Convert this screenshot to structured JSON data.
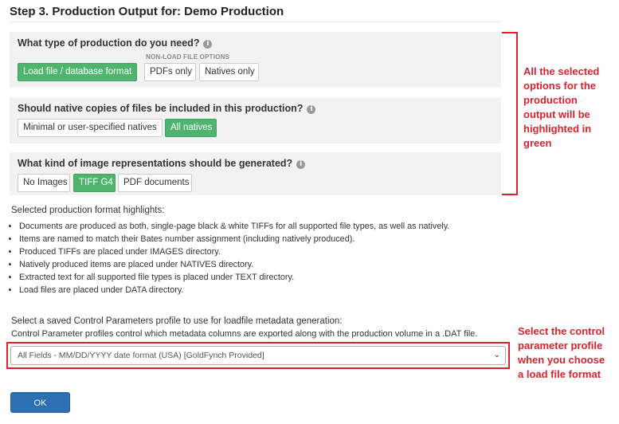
{
  "step_title": "Step 3. Production Output for: Demo Production",
  "panels": {
    "production_type": {
      "question": "What type of production do you need?",
      "options": [
        {
          "label": "Load file / database format",
          "selected": true
        },
        {
          "label": "PDFs only",
          "selected": false
        },
        {
          "label": "Natives only",
          "selected": false
        }
      ],
      "group_label": "NON-LOAD FILE OPTIONS"
    },
    "native_copies": {
      "question": "Should native copies of files be included in this production?",
      "options": [
        {
          "label": "Minimal or user-specified natives",
          "selected": false
        },
        {
          "label": "All natives",
          "selected": true
        }
      ]
    },
    "image_representations": {
      "question": "What kind of image representations should be generated?",
      "options": [
        {
          "label": "No Images",
          "selected": false
        },
        {
          "label": "TIFF G4",
          "selected": true
        },
        {
          "label": "PDF documents",
          "selected": false
        }
      ]
    }
  },
  "highlights": {
    "title": "Selected production format highlights:",
    "items": [
      "Documents are produced as both, single-page black & white TIFFs for all supported file types, as well as natively.",
      "Items are named to match their Bates number assignment (including natively produced).",
      "Produced TIFFs are placed under IMAGES directory.",
      "Natively produced items are placed under NATIVES directory.",
      "Extracted text for all supported file types is placed under TEXT directory.",
      "Load files are placed under DATA directory."
    ]
  },
  "control_params": {
    "label": "Select a saved Control Parameters profile to use for loadfile metadata generation:",
    "description": "Control Parameter profiles control which metadata columns are exported along with the production volume in a .DAT file.",
    "selected": "All Fields - MM/DD/YYYY date format (USA) [GoldFynch Provided]"
  },
  "ok_label": "OK",
  "annotations": {
    "options_note": [
      "All the selected",
      "options for the",
      "production",
      "output will be",
      "highlighted in",
      "green"
    ],
    "profile_note": [
      "Select the control",
      "parameter profile",
      "when you choose",
      "a load file format"
    ]
  },
  "colors": {
    "selected_green": "#4fb46e",
    "annotation_red": "#d9232d",
    "ok_blue": "#2c6fb5"
  }
}
